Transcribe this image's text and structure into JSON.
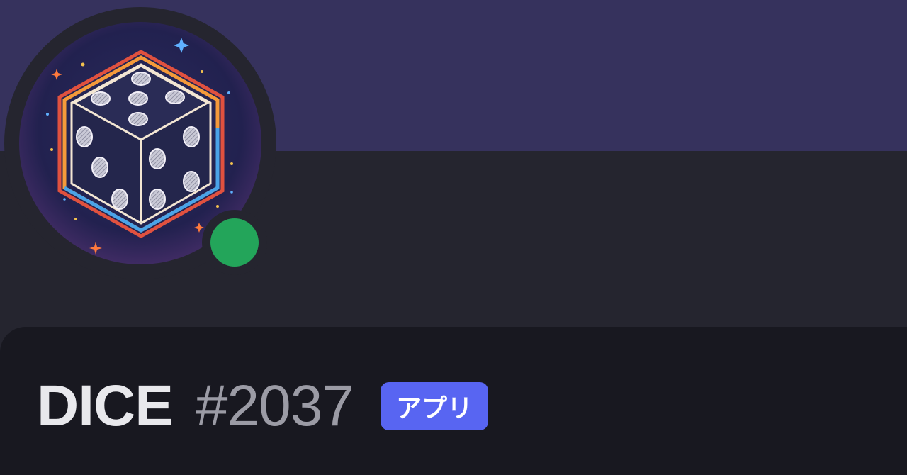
{
  "profile": {
    "username": "DICE",
    "discriminator": "#2037",
    "badge_label": "アプリ",
    "status": "online",
    "status_color": "#23a55a",
    "banner_color": "#36325d",
    "badge_color": "#5865f2",
    "avatar_icon": "dice-icon"
  }
}
